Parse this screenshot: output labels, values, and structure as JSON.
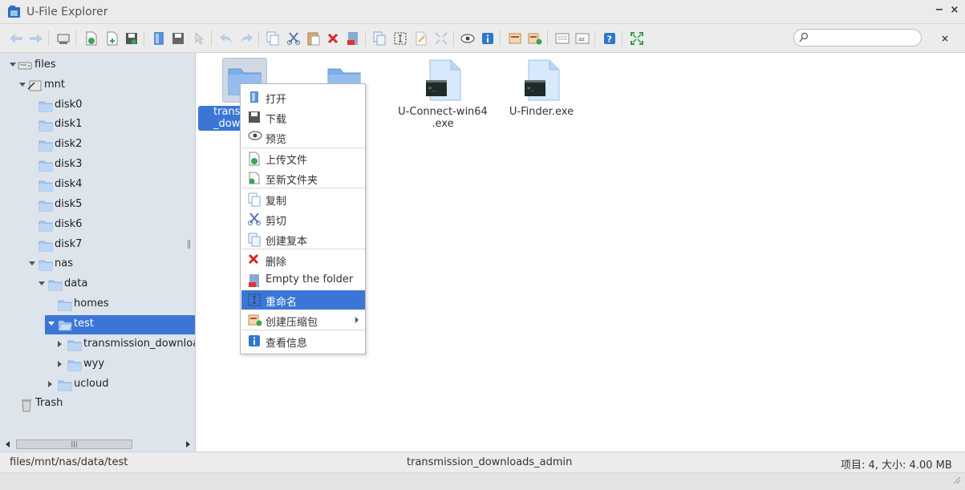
{
  "window": {
    "title": "U-File Explorer",
    "minimize_glyph": "−",
    "close_glyph": "×"
  },
  "toolbar": {
    "buttons": [
      "back-icon",
      "forward-icon",
      "home-icon",
      "upload-icon",
      "new-file-icon",
      "save-icon",
      "select-icon",
      "save-as-icon",
      "pointer-icon",
      "undo-icon",
      "redo-icon",
      "copy-icon",
      "cut-icon",
      "paste-icon",
      "delete-icon",
      "empty-folder-icon",
      "duplicate-icon",
      "rename-icon",
      "edit-icon",
      "resize-icon",
      "preview-icon",
      "info-icon",
      "extract-icon",
      "archive-icon",
      "view-list-icon",
      "sort-icon",
      "help-icon",
      "fullscreen-icon"
    ],
    "search": {
      "placeholder": "",
      "value": ""
    },
    "search_clear": "×"
  },
  "sidebar": {
    "tree": [
      {
        "label": "files",
        "icon": "drive-icon",
        "expanded": true
      },
      {
        "label": "mnt",
        "icon": "mount-icon",
        "expanded": true
      },
      {
        "label": "disk0",
        "icon": "folder-icon"
      },
      {
        "label": "disk1",
        "icon": "folder-icon"
      },
      {
        "label": "disk2",
        "icon": "folder-icon"
      },
      {
        "label": "disk3",
        "icon": "folder-icon"
      },
      {
        "label": "disk4",
        "icon": "folder-icon"
      },
      {
        "label": "disk5",
        "icon": "folder-icon"
      },
      {
        "label": "disk6",
        "icon": "folder-icon"
      },
      {
        "label": "disk7",
        "icon": "folder-icon"
      },
      {
        "label": "nas",
        "icon": "folder-icon",
        "expanded": true
      },
      {
        "label": "data",
        "icon": "folder-icon",
        "expanded": true
      },
      {
        "label": "homes",
        "icon": "folder-icon"
      },
      {
        "label": "test",
        "icon": "folder-open-icon",
        "expanded": true,
        "selected": true
      },
      {
        "label": "transmission_downloa",
        "icon": "folder-icon",
        "collapsed": true
      },
      {
        "label": "wyy",
        "icon": "folder-icon",
        "collapsed": true
      },
      {
        "label": "ucloud",
        "icon": "folder-icon",
        "collapsed": true
      },
      {
        "label": "Trash",
        "icon": "trash-icon"
      }
    ],
    "scroll_grip": "|||"
  },
  "main": {
    "files": [
      {
        "name": "trans\n_dow",
        "type": "folder",
        "selected": true
      },
      {
        "name": "",
        "type": "folder"
      },
      {
        "name": "U-Connect-win64\n.exe",
        "type": "exe"
      },
      {
        "name": "U-Finder.exe",
        "type": "exe"
      }
    ]
  },
  "context_menu": {
    "items": [
      {
        "label": "打开",
        "icon": "open-icon"
      },
      {
        "label": "下载",
        "icon": "download-icon"
      },
      {
        "label": "预览",
        "icon": "preview-icon"
      },
      {
        "label": "上传文件",
        "icon": "upload-icon"
      },
      {
        "label": "至新文件夹",
        "icon": "new-folder-icon"
      },
      {
        "label": "复制",
        "icon": "copy-icon"
      },
      {
        "label": "剪切",
        "icon": "cut-icon"
      },
      {
        "label": "创建复本",
        "icon": "duplicate-icon"
      },
      {
        "label": "删除",
        "icon": "delete-icon"
      },
      {
        "label": "Empty the folder",
        "icon": "empty-folder-icon"
      },
      {
        "label": "重命名",
        "icon": "rename-icon",
        "active": true
      },
      {
        "label": "创建压缩包",
        "icon": "archive-icon",
        "submenu": true
      },
      {
        "label": "查看信息",
        "icon": "info-icon"
      }
    ]
  },
  "statusbar": {
    "path": "files/mnt/nas/data/test",
    "selected_name": "transmission_downloads_admin",
    "summary": "项目: 4, 大小: 4.00 MB"
  },
  "colors": {
    "accent": "#3b76d6",
    "sidebar_bg": "#dde4ec"
  }
}
